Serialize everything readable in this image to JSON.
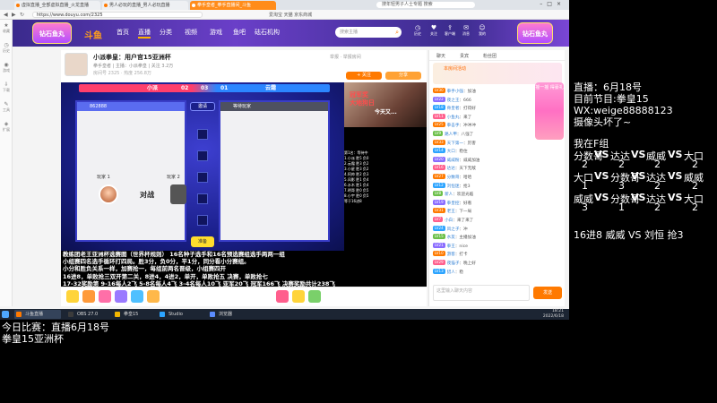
{
  "browser": {
    "tabs": [
      {
        "label": "虚拟直播_全部虚拟直播_火龙直播"
      },
      {
        "label": "男人必玩的直播_男人必玩直播"
      },
      {
        "label": "拳手皇者_拳手直播间_斗鱼"
      }
    ],
    "tab_search": "搜年轻男子人士专题 搜索",
    "address": "https://www.douyu.com/2325",
    "bookmarks": "爱淘宝  天猫  京东商城"
  },
  "browser_sidebar": [
    "收藏",
    "历史",
    "游戏",
    "下载",
    "工具",
    "扩展"
  ],
  "douyu": {
    "logo_text": "斗鱼",
    "nav": [
      "首页",
      "直播",
      "分类",
      "视频",
      "游戏",
      "鱼吧",
      "砝石机构"
    ],
    "search_placeholder": "搜索主播",
    "icons": [
      {
        "icon": "history-icon",
        "label": "历史"
      },
      {
        "icon": "follow-icon",
        "label": "关注"
      },
      {
        "icon": "upload-icon",
        "label": "客户端"
      },
      {
        "icon": "message-icon",
        "label": "消息"
      },
      {
        "icon": "user-icon",
        "label": "我的"
      }
    ],
    "badge_left": "钻石鱼丸",
    "badge_right": "钻石鱼丸"
  },
  "room": {
    "title": "小派拳皇：用户官15亚洲杯",
    "meta": "拳手皇者  |  主播：小派拳皇  |  关注 3.2万",
    "meta2": "房间号 2325  ·  热度 256.8万",
    "follow_label": "+ 关注",
    "share_label": "分享",
    "report_label": "举报 · 举报房间"
  },
  "game": {
    "score_left": "小派",
    "score_nums": [
      "02",
      "03",
      "01"
    ],
    "score_right": "云霜",
    "invite_label": "邀请",
    "ready_label": "准备",
    "p1_label": "玩家 1",
    "p2_label": "玩家 2",
    "vs_label": "对战",
    "left_header": "862888",
    "right_header": "等待玩家"
  },
  "cam": {
    "text1": "冠军奖",
    "text2": "大地狗日",
    "text3": "今天又..."
  },
  "rank_list": [
    "第1名：等待中",
    "1.小派  胜5  负0",
    "2.云霜  胜3  负2",
    "3.小星  胜3  负2",
    "4.阿帅  胜2  负3",
    "5.风影  胜1  负4",
    "6.水木  胜1  负4",
    "7.明哥  胜0  负5",
    "8.小宇  胜0  负5",
    "等于16进8"
  ],
  "overlay_rules": [
    "教练团老王亚洲杯选赛图（世界杯规则）  16名种子选手和16名预选赛组选手两两一组",
    "小组赛四名选手循环打四局。胜3分，负0分，平1分，同分看小分赛组。",
    "小分和胜负关系一样，加赛抢一，每组前两名晋级，小组赛四开",
    "16进8，单败抢三双开第二关，8进4，4进2，单开，单败抢五  决赛，单败抢七",
    "17-32奖励第 9-16每人2飞 5-8名每人4飞 3-4名每人10飞 亚军20飞 冠军166飞  决赛奖励共计238飞"
  ],
  "chat": {
    "tabs": [
      "聊天",
      "贵宾",
      "粉丝团"
    ],
    "banner_title": "本房间活动",
    "lines": [
      {
        "badge": "LV30",
        "color": "#ff7a00",
        "name": "拳手小强",
        "text": "：加油"
      },
      {
        "badge": "LV22",
        "color": "#8a6cff",
        "name": "夜之王",
        "text": "：666"
      },
      {
        "badge": "LV18",
        "color": "#2ca4ff",
        "name": "骨皇者",
        "text": "：打得好"
      },
      {
        "badge": "LV11",
        "color": "#ff5f8d",
        "name": "小鱼丸",
        "text": "：来了"
      },
      {
        "badge": "LV25",
        "color": "#ff7a00",
        "name": "拳击手",
        "text": "：冲冲冲"
      },
      {
        "badge": "LV9",
        "color": "#6cc04a",
        "name": "路人甲",
        "text": "：八强了"
      },
      {
        "badge": "LV33",
        "color": "#ff7a00",
        "name": "天下第一",
        "text": "：厉害"
      },
      {
        "badge": "LV14",
        "color": "#2ca4ff",
        "name": "大口",
        "text": "：稳住"
      },
      {
        "badge": "LV20",
        "color": "#8a6cff",
        "name": "威威粉",
        "text": "：威威加油"
      },
      {
        "badge": "LV16",
        "color": "#ff5f8d",
        "name": "达达",
        "text": "：天下无敌"
      },
      {
        "badge": "LV27",
        "color": "#ff7a00",
        "name": "分数哥",
        "text": "：哈哈"
      },
      {
        "badge": "LV12",
        "color": "#2ca4ff",
        "name": "刘恒迷",
        "text": "：抢3"
      },
      {
        "badge": "LV8",
        "color": "#6cc04a",
        "name": "新人",
        "text": "：欢迎光临"
      },
      {
        "badge": "LV19",
        "color": "#8a6cff",
        "name": "拳皇控",
        "text": "：好看"
      },
      {
        "badge": "LV31",
        "color": "#ff7a00",
        "name": "老王",
        "text": "：下一局"
      },
      {
        "badge": "LV7",
        "color": "#ff5f8d",
        "name": "小白",
        "text": "：来了来了"
      },
      {
        "badge": "LV24",
        "color": "#2ca4ff",
        "name": "风之子",
        "text": "：冲"
      },
      {
        "badge": "LV15",
        "color": "#6cc04a",
        "name": "水友",
        "text": "：主播加油"
      },
      {
        "badge": "LV21",
        "color": "#8a6cff",
        "name": "拳王",
        "text": "：nice"
      },
      {
        "badge": "LV10",
        "color": "#ff7a00",
        "name": "游客",
        "text": "：打卡"
      },
      {
        "badge": "LV29",
        "color": "#ff5f8d",
        "name": "夜猫子",
        "text": "：晚上好"
      },
      {
        "badge": "LV13",
        "color": "#2ca4ff",
        "name": "猎人",
        "text": "：稳"
      }
    ],
    "input_placeholder": "这里输入聊天内容",
    "send_label": "发送"
  },
  "right_ad": "摇一摇 得豪礼",
  "taskbar": {
    "items": [
      {
        "label": "斗鱼直播",
        "color": "#ff7a00"
      },
      {
        "label": "OBS 27.0",
        "color": "#3b3b3b"
      },
      {
        "label": "拳皇15",
        "color": "#f2b600"
      },
      {
        "label": "Studio",
        "color": "#2ca4ff"
      },
      {
        "label": "浏览器",
        "color": "#5b8cff"
      }
    ],
    "clock_time": "18:21",
    "clock_date": "2022/6/18"
  },
  "overlay": {
    "bottom_line1": "今日比赛：直播6月18号",
    "bottom_line2": "拳皇15亚洲杯",
    "info_lines": [
      "直播：6月18号",
      "目前节目:拳皇15",
      "WX:weige88888123",
      "摄像头坏了~"
    ],
    "group_title": "我在F组",
    "matches": [
      {
        "a": "分数哥",
        "b": "达达",
        "c": "威威",
        "d": "大口",
        "sa": "2",
        "sb": "2",
        "sc": "2",
        "sd": "2"
      },
      {
        "a": "大口",
        "b": "分数哥",
        "c": "达达",
        "d": "威威",
        "sa": "1",
        "sb": "3",
        "sc": "2",
        "sd": "2"
      },
      {
        "a": "威威",
        "b": "分数哥",
        "c": "达达",
        "d": "大口",
        "sa": "3",
        "sb": "1",
        "sc": "2",
        "sd": "2"
      }
    ],
    "vs_label": "VS",
    "knockout": "16进8 威威 VS 刘恒 抢3"
  }
}
